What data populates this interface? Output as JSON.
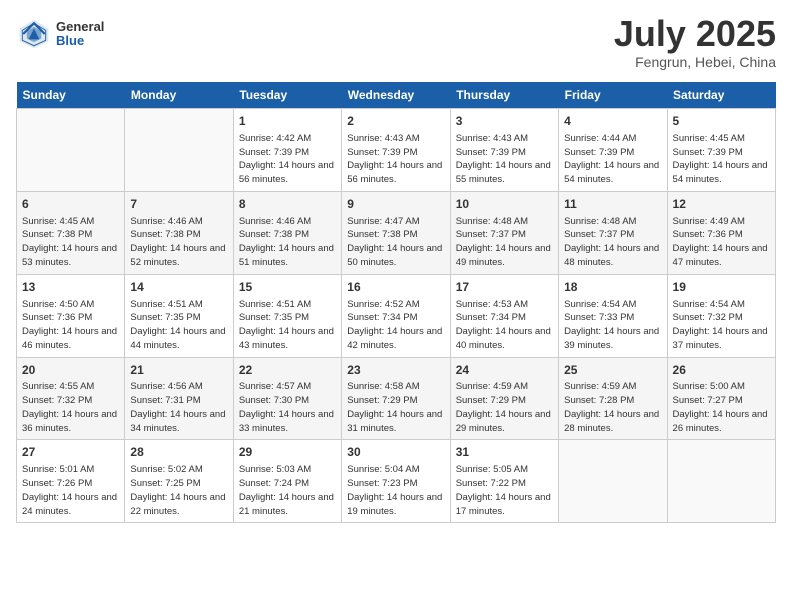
{
  "header": {
    "logo": {
      "general": "General",
      "blue": "Blue"
    },
    "month_year": "July 2025",
    "location": "Fengrun, Hebei, China"
  },
  "weekdays": [
    "Sunday",
    "Monday",
    "Tuesday",
    "Wednesday",
    "Thursday",
    "Friday",
    "Saturday"
  ],
  "weeks": [
    [
      {
        "day": "",
        "sunrise": "",
        "sunset": "",
        "daylight": ""
      },
      {
        "day": "",
        "sunrise": "",
        "sunset": "",
        "daylight": ""
      },
      {
        "day": "1",
        "sunrise": "Sunrise: 4:42 AM",
        "sunset": "Sunset: 7:39 PM",
        "daylight": "Daylight: 14 hours and 56 minutes."
      },
      {
        "day": "2",
        "sunrise": "Sunrise: 4:43 AM",
        "sunset": "Sunset: 7:39 PM",
        "daylight": "Daylight: 14 hours and 56 minutes."
      },
      {
        "day": "3",
        "sunrise": "Sunrise: 4:43 AM",
        "sunset": "Sunset: 7:39 PM",
        "daylight": "Daylight: 14 hours and 55 minutes."
      },
      {
        "day": "4",
        "sunrise": "Sunrise: 4:44 AM",
        "sunset": "Sunset: 7:39 PM",
        "daylight": "Daylight: 14 hours and 54 minutes."
      },
      {
        "day": "5",
        "sunrise": "Sunrise: 4:45 AM",
        "sunset": "Sunset: 7:39 PM",
        "daylight": "Daylight: 14 hours and 54 minutes."
      }
    ],
    [
      {
        "day": "6",
        "sunrise": "Sunrise: 4:45 AM",
        "sunset": "Sunset: 7:38 PM",
        "daylight": "Daylight: 14 hours and 53 minutes."
      },
      {
        "day": "7",
        "sunrise": "Sunrise: 4:46 AM",
        "sunset": "Sunset: 7:38 PM",
        "daylight": "Daylight: 14 hours and 52 minutes."
      },
      {
        "day": "8",
        "sunrise": "Sunrise: 4:46 AM",
        "sunset": "Sunset: 7:38 PM",
        "daylight": "Daylight: 14 hours and 51 minutes."
      },
      {
        "day": "9",
        "sunrise": "Sunrise: 4:47 AM",
        "sunset": "Sunset: 7:38 PM",
        "daylight": "Daylight: 14 hours and 50 minutes."
      },
      {
        "day": "10",
        "sunrise": "Sunrise: 4:48 AM",
        "sunset": "Sunset: 7:37 PM",
        "daylight": "Daylight: 14 hours and 49 minutes."
      },
      {
        "day": "11",
        "sunrise": "Sunrise: 4:48 AM",
        "sunset": "Sunset: 7:37 PM",
        "daylight": "Daylight: 14 hours and 48 minutes."
      },
      {
        "day": "12",
        "sunrise": "Sunrise: 4:49 AM",
        "sunset": "Sunset: 7:36 PM",
        "daylight": "Daylight: 14 hours and 47 minutes."
      }
    ],
    [
      {
        "day": "13",
        "sunrise": "Sunrise: 4:50 AM",
        "sunset": "Sunset: 7:36 PM",
        "daylight": "Daylight: 14 hours and 46 minutes."
      },
      {
        "day": "14",
        "sunrise": "Sunrise: 4:51 AM",
        "sunset": "Sunset: 7:35 PM",
        "daylight": "Daylight: 14 hours and 44 minutes."
      },
      {
        "day": "15",
        "sunrise": "Sunrise: 4:51 AM",
        "sunset": "Sunset: 7:35 PM",
        "daylight": "Daylight: 14 hours and 43 minutes."
      },
      {
        "day": "16",
        "sunrise": "Sunrise: 4:52 AM",
        "sunset": "Sunset: 7:34 PM",
        "daylight": "Daylight: 14 hours and 42 minutes."
      },
      {
        "day": "17",
        "sunrise": "Sunrise: 4:53 AM",
        "sunset": "Sunset: 7:34 PM",
        "daylight": "Daylight: 14 hours and 40 minutes."
      },
      {
        "day": "18",
        "sunrise": "Sunrise: 4:54 AM",
        "sunset": "Sunset: 7:33 PM",
        "daylight": "Daylight: 14 hours and 39 minutes."
      },
      {
        "day": "19",
        "sunrise": "Sunrise: 4:54 AM",
        "sunset": "Sunset: 7:32 PM",
        "daylight": "Daylight: 14 hours and 37 minutes."
      }
    ],
    [
      {
        "day": "20",
        "sunrise": "Sunrise: 4:55 AM",
        "sunset": "Sunset: 7:32 PM",
        "daylight": "Daylight: 14 hours and 36 minutes."
      },
      {
        "day": "21",
        "sunrise": "Sunrise: 4:56 AM",
        "sunset": "Sunset: 7:31 PM",
        "daylight": "Daylight: 14 hours and 34 minutes."
      },
      {
        "day": "22",
        "sunrise": "Sunrise: 4:57 AM",
        "sunset": "Sunset: 7:30 PM",
        "daylight": "Daylight: 14 hours and 33 minutes."
      },
      {
        "day": "23",
        "sunrise": "Sunrise: 4:58 AM",
        "sunset": "Sunset: 7:29 PM",
        "daylight": "Daylight: 14 hours and 31 minutes."
      },
      {
        "day": "24",
        "sunrise": "Sunrise: 4:59 AM",
        "sunset": "Sunset: 7:29 PM",
        "daylight": "Daylight: 14 hours and 29 minutes."
      },
      {
        "day": "25",
        "sunrise": "Sunrise: 4:59 AM",
        "sunset": "Sunset: 7:28 PM",
        "daylight": "Daylight: 14 hours and 28 minutes."
      },
      {
        "day": "26",
        "sunrise": "Sunrise: 5:00 AM",
        "sunset": "Sunset: 7:27 PM",
        "daylight": "Daylight: 14 hours and 26 minutes."
      }
    ],
    [
      {
        "day": "27",
        "sunrise": "Sunrise: 5:01 AM",
        "sunset": "Sunset: 7:26 PM",
        "daylight": "Daylight: 14 hours and 24 minutes."
      },
      {
        "day": "28",
        "sunrise": "Sunrise: 5:02 AM",
        "sunset": "Sunset: 7:25 PM",
        "daylight": "Daylight: 14 hours and 22 minutes."
      },
      {
        "day": "29",
        "sunrise": "Sunrise: 5:03 AM",
        "sunset": "Sunset: 7:24 PM",
        "daylight": "Daylight: 14 hours and 21 minutes."
      },
      {
        "day": "30",
        "sunrise": "Sunrise: 5:04 AM",
        "sunset": "Sunset: 7:23 PM",
        "daylight": "Daylight: 14 hours and 19 minutes."
      },
      {
        "day": "31",
        "sunrise": "Sunrise: 5:05 AM",
        "sunset": "Sunset: 7:22 PM",
        "daylight": "Daylight: 14 hours and 17 minutes."
      },
      {
        "day": "",
        "sunrise": "",
        "sunset": "",
        "daylight": ""
      },
      {
        "day": "",
        "sunrise": "",
        "sunset": "",
        "daylight": ""
      }
    ]
  ]
}
